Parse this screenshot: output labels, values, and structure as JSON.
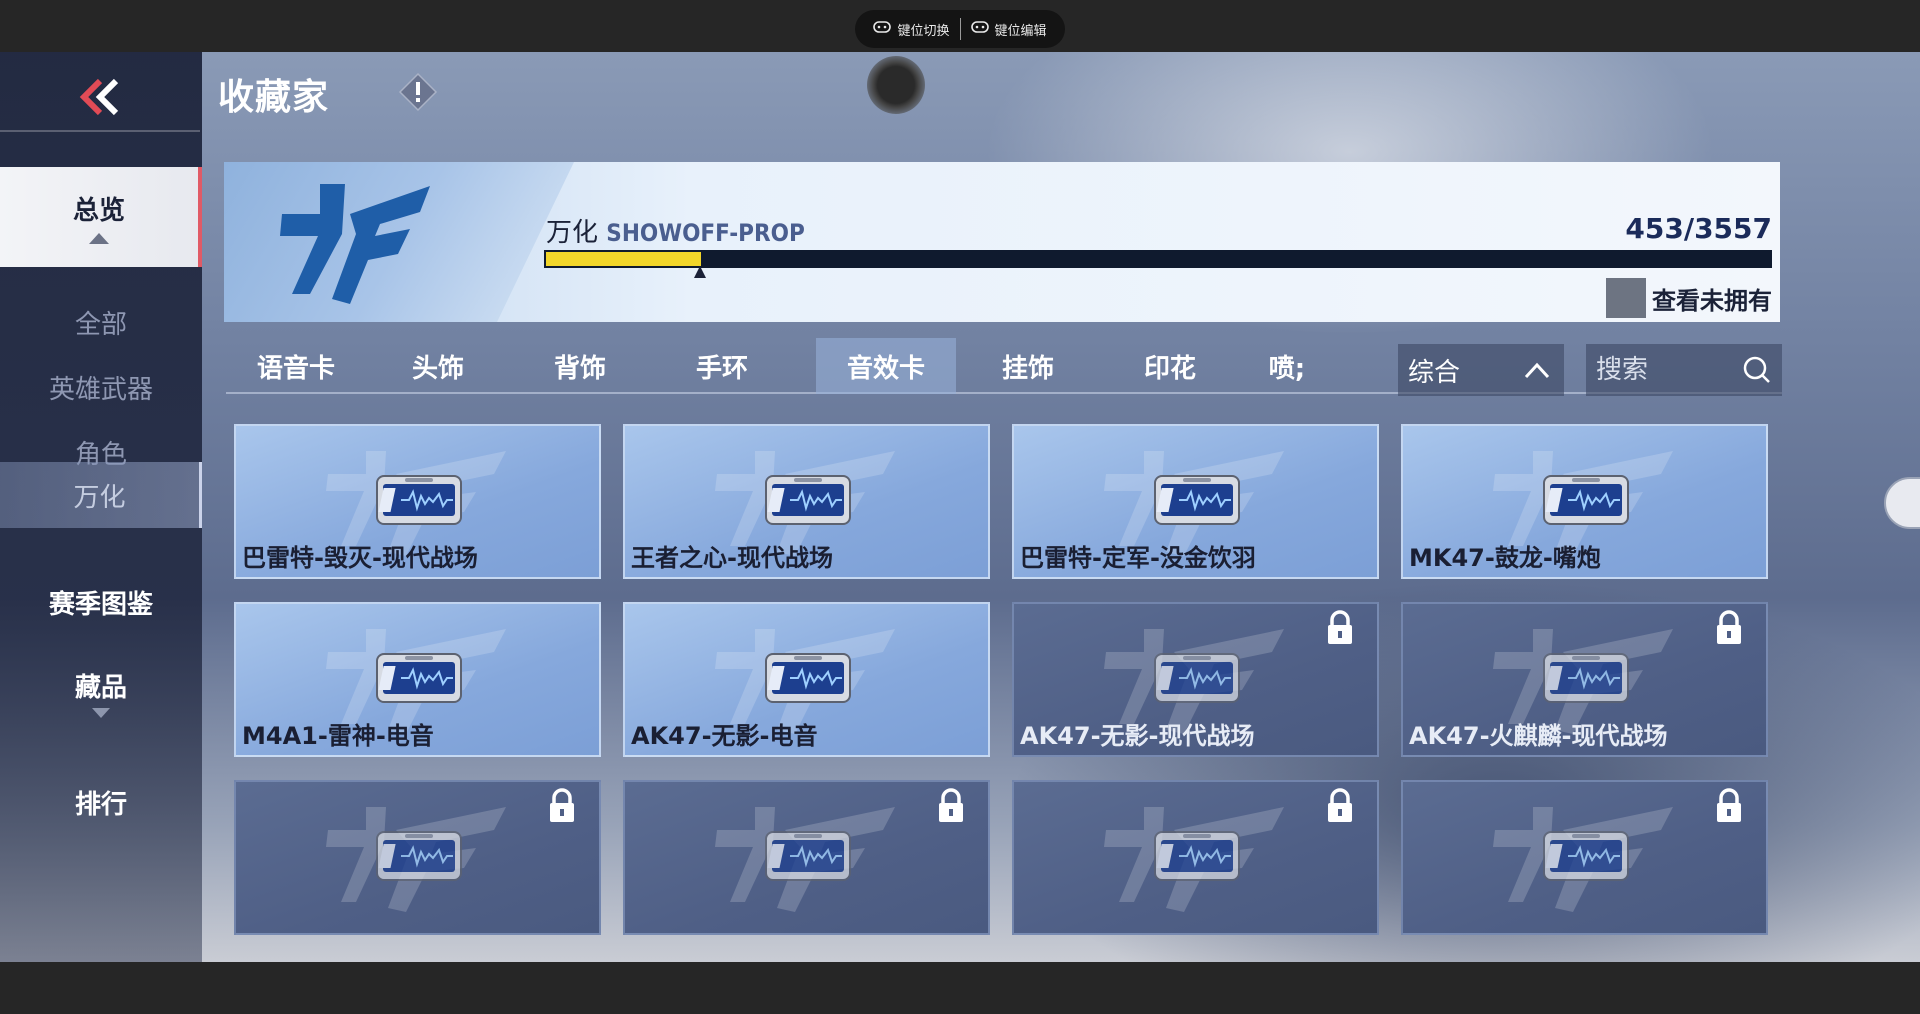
{
  "emulator": {
    "key_switch": "键位切换",
    "key_edit": "键位编辑"
  },
  "header": {
    "title": "收藏家"
  },
  "sidebar": {
    "overview": "总览",
    "sub_all": "全部",
    "sub_hero": "英雄武器",
    "sub_role": "角色",
    "sub_wanhua": "万化",
    "season": "赛季图鉴",
    "collection": "藏品",
    "ranking": "排行"
  },
  "banner": {
    "label_cn": "万化",
    "label_en": "SHOWOFF-PROP",
    "count": "453/3557",
    "progress_fraction": 0.127,
    "view_unowned": "查看未拥有"
  },
  "tabs": [
    "语音卡",
    "头饰",
    "背饰",
    "手环",
    "音效卡",
    "挂饰",
    "印花",
    "喷涂"
  ],
  "tabs_visible": [
    "语音卡",
    "头饰",
    "背饰",
    "手环",
    "音效卡",
    "挂饰",
    "印花",
    "喷;"
  ],
  "active_tab": "音效卡",
  "sort": {
    "label": "综合"
  },
  "search": {
    "placeholder": "搜索"
  },
  "cards": [
    {
      "name": "巴雷特-毁灭-现代战场",
      "locked": false
    },
    {
      "name": "王者之心-现代战场",
      "locked": false
    },
    {
      "name": "巴雷特-定军-没金饮羽",
      "locked": false
    },
    {
      "name": "MK47-鼓龙-嘴炮",
      "locked": false
    },
    {
      "name": "M4A1-雷神-电音",
      "locked": false
    },
    {
      "name": "AK47-无影-电音",
      "locked": false
    },
    {
      "name": "AK47-无影-现代战场",
      "locked": true
    },
    {
      "name": "AK47-火麒麟-现代战场",
      "locked": true
    },
    {
      "name": "",
      "locked": true
    },
    {
      "name": "",
      "locked": true
    },
    {
      "name": "",
      "locked": true
    },
    {
      "name": "",
      "locked": true
    }
  ],
  "colors": {
    "accent": "#f2d62a",
    "active_indicator": "#e05a66",
    "dark_text": "#1b2238"
  }
}
